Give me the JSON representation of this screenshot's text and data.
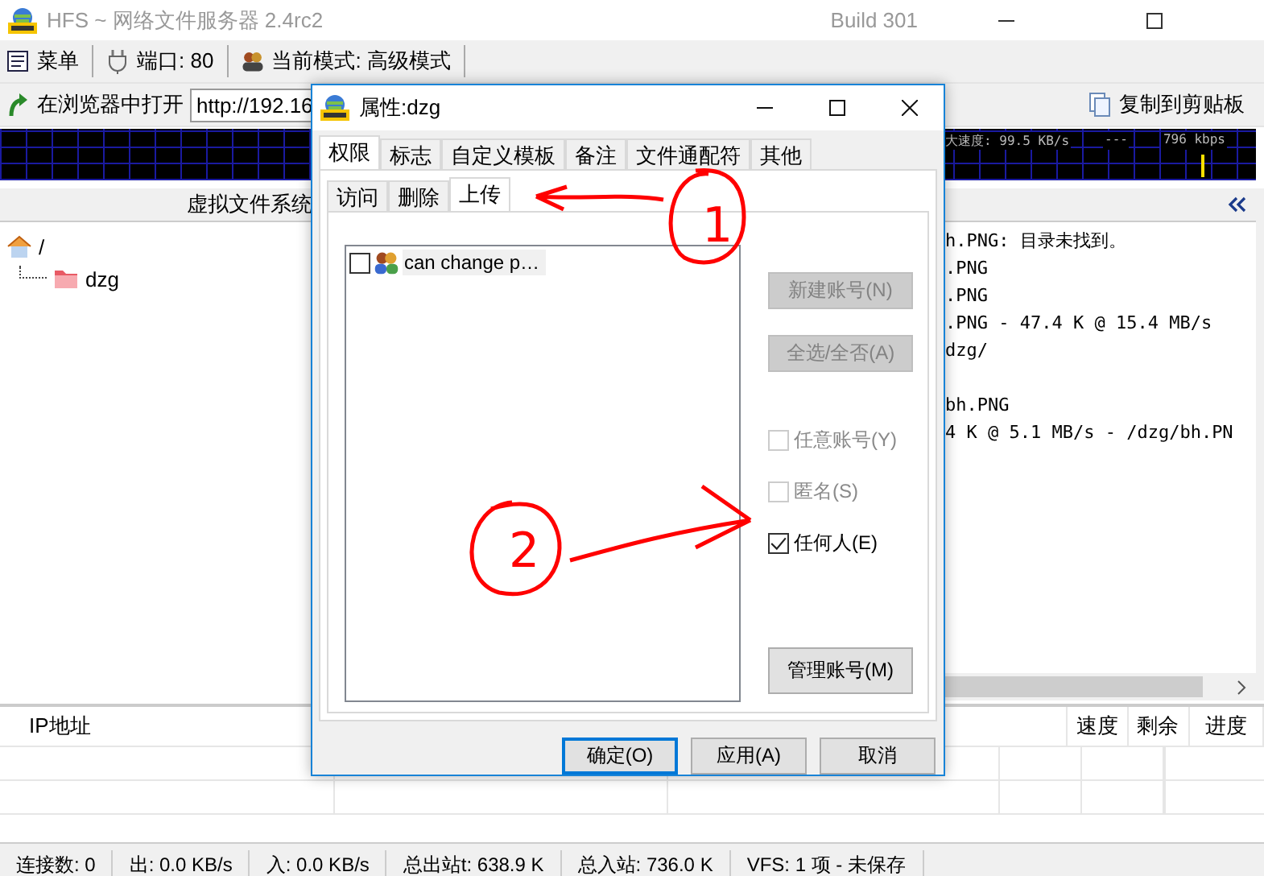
{
  "window": {
    "title": "HFS ~ 网络文件服务器 2.4rc2",
    "build": "Build 301"
  },
  "toolbar": [
    {
      "kind": "menu",
      "label": "菜单"
    },
    {
      "kind": "port",
      "label": "端口: 80"
    },
    {
      "kind": "mode",
      "label": "当前模式: 高级模式"
    }
  ],
  "address_bar": {
    "open_button": "在浏览器中打开",
    "url": "http://192.16",
    "copy_button": "复制到剪贴板"
  },
  "graph": {
    "reading": "大速度: 99.5 KB/s",
    "separator": "---",
    "rate": "796 kbps"
  },
  "vfs": {
    "title": "虚拟文件系统",
    "tree": [
      {
        "name": "/",
        "kind": "home",
        "children": [
          {
            "name": "dzg",
            "kind": "folder"
          }
        ]
      }
    ]
  },
  "log": {
    "groups": [
      [
        "h.PNG: 目录未找到。",
        ".PNG",
        ".PNG",
        ".PNG - 47.4 K @ 15.4 MB/s",
        "dzg/"
      ],
      [
        "bh.PNG",
        "4 K @ 5.1 MB/s - /dzg/bh.PN"
      ]
    ]
  },
  "connections": {
    "columns": [
      "IP地址",
      "速度",
      "剩余",
      "进度"
    ]
  },
  "status_bar": [
    "连接数: 0",
    "出: 0.0 KB/s",
    "入: 0.0 KB/s",
    "总出站t: 638.9 K",
    "总入站: 736.0 K",
    "VFS: 1 项 - 未保存"
  ],
  "dialog": {
    "title": "属性:dzg",
    "tabs": [
      {
        "label": "权限",
        "selected": true
      },
      {
        "label": "标志",
        "selected": false
      },
      {
        "label": "自定义模板",
        "selected": false
      },
      {
        "label": "备注",
        "selected": false
      },
      {
        "label": "文件通配符",
        "selected": false
      },
      {
        "label": "其他",
        "selected": false
      }
    ],
    "subtabs": [
      {
        "label": "访问",
        "selected": false
      },
      {
        "label": "删除",
        "selected": false
      },
      {
        "label": "上传",
        "selected": true
      }
    ],
    "accounts": [
      {
        "label": "can change p…",
        "checked": false
      }
    ],
    "buttons": [
      {
        "label": "新建账号(N)",
        "disabled": true
      },
      {
        "label": "全选/全否(A)",
        "disabled": true
      }
    ],
    "options": [
      {
        "label": "任意账号(Y)",
        "checked": false,
        "disabled": true
      },
      {
        "label": "匿名(S)",
        "checked": false,
        "disabled": true
      },
      {
        "label": "任何人(E)",
        "checked": true,
        "disabled": false
      }
    ],
    "manage_button": "管理账号(M)",
    "footer_buttons": [
      {
        "label": "确定(O)",
        "default": true
      },
      {
        "label": "应用(A)",
        "default": false
      },
      {
        "label": "取消",
        "default": false
      }
    ]
  },
  "annotations": [
    {
      "label": "1"
    },
    {
      "label": "2"
    }
  ]
}
